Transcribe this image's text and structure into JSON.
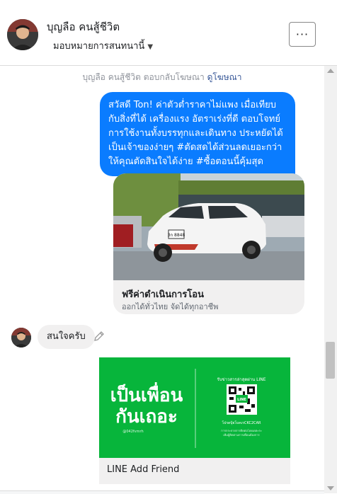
{
  "header": {
    "contact_name": "บุญลือ คนสู้ชีวิต",
    "assign_label": "มอบหมายการสนทนานี้",
    "more_label": "···"
  },
  "conversation": {
    "system_note_prefix": "บุญลือ คนสู้ชีวิต ตอบกลับโฆษณา",
    "system_note_link": "ดูโฆษณา",
    "outgoing_message": "สวัสดี Ton! ค่าตัวต่ำราคาไม่แพง เมื่อเทียบกับสิ่งที่ได้ เครื่องแรง อัตราเร่งที่ดี ตอบโจทย์การใช้งานทั้งบรรทุกและเดินทาง ประหยัดได้ เป็นเจ้าของง่ายๆ #ตัดสดได้ส่วนลดเยอะกว่า ให้คุณตัดสินใจได้ง่าย #ซื้อตอนนี้คุ้มสุด",
    "ad_card": {
      "title": "ฟรีค่าดำเนินการโอน",
      "subtitle": "ออกได้ทั่วไทย จัดได้ทุกอาชีพ",
      "plate_text": "3ก 8848"
    },
    "incoming_message": "สนใจครับ",
    "line_card": {
      "headline_1": "เป็นเพื่อน",
      "headline_2": "กันเถอะ",
      "handle": "@042fvmrh",
      "qr_heading": "รับข่าวสารล่าสุดผ่าน LINE",
      "qr_caption": "โปรดบุ้ยโบคเรCKC2CAR",
      "qr_note_1": "การกระจายการติดต่อโดยเดตะระ",
      "qr_note_2": "เพิ่มผู้ติดตามการเพื่อนต้องการ",
      "logo_text": "LINE",
      "title": "LINE Add Friend"
    }
  },
  "colors": {
    "accent_blue": "#0a7cff",
    "link_blue": "#385898",
    "line_green": "#07b53b",
    "bubble_gray": "#f1f0f0"
  }
}
